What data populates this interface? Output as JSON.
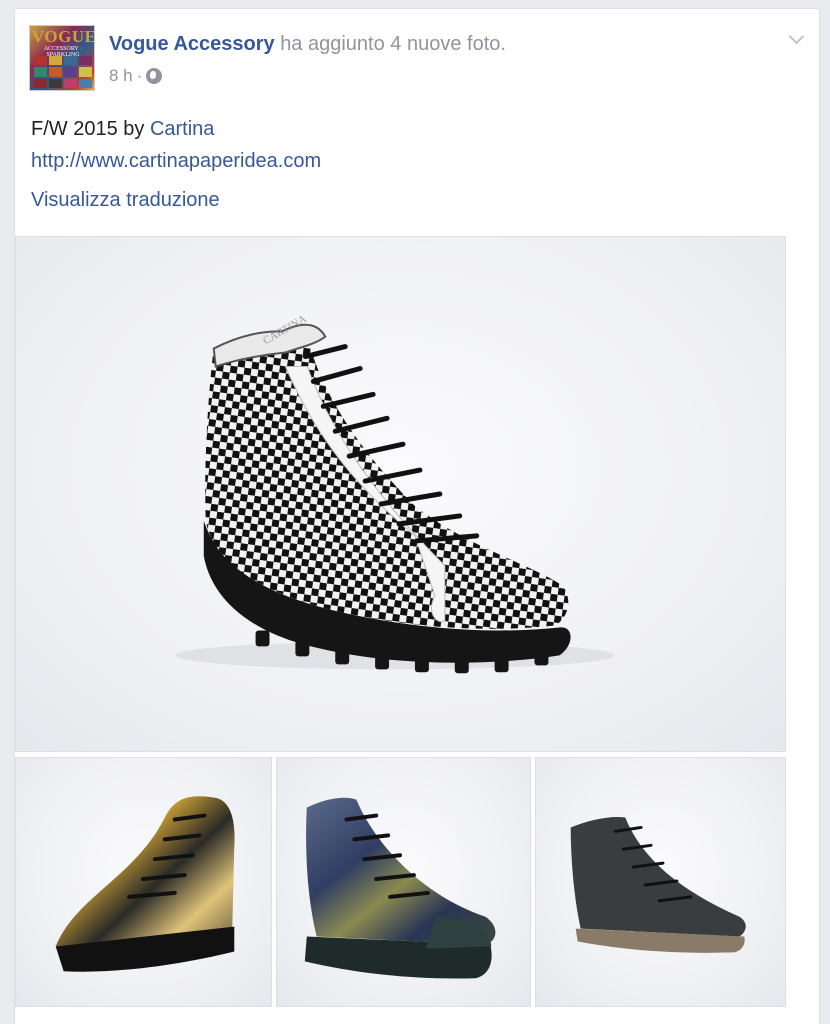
{
  "post": {
    "author": "Vogue Accessory",
    "action": "ha aggiunto 4 nuove foto.",
    "time": "8 h",
    "separator": "·",
    "privacy_icon": "globe-icon",
    "caption_prefix": "F/W 2015 by ",
    "caption_page": "Cartina",
    "caption_link": "http://www.cartinapaperidea.com",
    "translate_label": "Visualizza traduzione"
  },
  "avatar": {
    "logo_text": "VOGUE",
    "sub_text": "ACCESSORY · SPARKLING",
    "logo_color": "#caa43a"
  },
  "photos": [
    {
      "subject": "checkered high-top sneaker",
      "brand_text": "CARTINA"
    },
    {
      "subject": "camouflage quilted high-top"
    },
    {
      "subject": "blue camouflage quilted high-top"
    },
    {
      "subject": "dark distressed high-top"
    }
  ],
  "colors": {
    "link": "#365899",
    "meta": "#90949c",
    "text": "#1d2129",
    "card_border": "#dddfe2",
    "background": "#e9ebee"
  }
}
